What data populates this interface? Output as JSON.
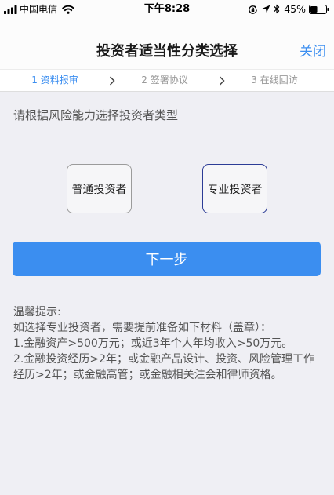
{
  "status_bar": {
    "carrier": "中国电信",
    "time": "下午8:28",
    "battery_percent": "45%",
    "battery_level": 0.45,
    "icons": [
      "signal-icon",
      "wifi-icon",
      "rotation-lock-icon",
      "location-icon",
      "bluetooth-icon",
      "battery-icon"
    ]
  },
  "nav_bar": {
    "title": "投资者适当性分类选择",
    "close_label": "关闭"
  },
  "steps": [
    {
      "label": "1 资料报审",
      "active": true
    },
    {
      "label": "2 签署协议",
      "active": false
    },
    {
      "label": "3 在线回访",
      "active": false
    }
  ],
  "main": {
    "prompt": "请根据风险能力选择投资者类型",
    "options": [
      {
        "label": "普通投资者",
        "selected": false
      },
      {
        "label": "专业投资者",
        "selected": true
      }
    ],
    "next_label": "下一步"
  },
  "tips": {
    "heading": "温馨提示:",
    "lines": [
      "如选择专业投资者，需要提前准备如下材料（盖章）：",
      "1.金融资产>500万元；或近3年个人年均收入>50万元。",
      "2.金融投资经历>2年；或金融产品设计、投资、风险管理工作经历>2年；或金融高管；或金融相关注会和律师资格。"
    ]
  },
  "colors": {
    "accent": "#3b8ef0",
    "selected_border": "#2c3c96",
    "unselected_border": "#9b9b9b",
    "background": "#efeff4"
  }
}
